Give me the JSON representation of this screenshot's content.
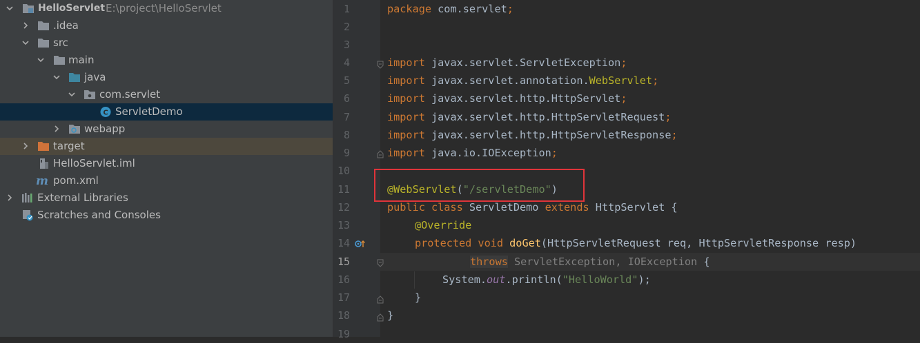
{
  "project_tree": {
    "root": {
      "name": "HelloServlet",
      "path": "E:\\project\\HelloServlet"
    },
    "items": [
      {
        "label": ".idea"
      },
      {
        "label": "src"
      },
      {
        "label": "main"
      },
      {
        "label": "java"
      },
      {
        "label": "com.servlet"
      },
      {
        "label": "ServletDemo"
      },
      {
        "label": "webapp"
      },
      {
        "label": "target"
      },
      {
        "label": "HelloServlet.iml"
      },
      {
        "label": "pom.xml"
      },
      {
        "label": "External Libraries"
      },
      {
        "label": "Scratches and Consoles"
      }
    ]
  },
  "editor": {
    "line_numbers": [
      "1",
      "2",
      "3",
      "4",
      "5",
      "6",
      "7",
      "8",
      "9",
      "10",
      "11",
      "12",
      "13",
      "14",
      "15",
      "16",
      "17",
      "18",
      "19"
    ],
    "current_line": "15",
    "tokens": {
      "package_kw": "package",
      "package_name": " com.servlet",
      "semi": ";",
      "import_kw": "import",
      "imp4": " javax.servlet.ServletException",
      "imp5a": " javax.servlet.annotation.",
      "imp5b": "WebServlet",
      "imp6": " javax.servlet.http.HttpServlet",
      "imp7": " javax.servlet.http.HttpServletRequest",
      "imp8": " javax.servlet.http.HttpServletResponse",
      "imp9": " java.io.IOException",
      "ann_webservlet": "@WebServlet",
      "paren_open": "(",
      "servlet_path": "\"/servletDemo\"",
      "paren_close": ")",
      "public_class": "public class ",
      "class_name": "ServletDemo ",
      "extends_kw": "extends ",
      "super_class": "HttpServlet {",
      "override": "@Override",
      "protected_void": "protected void ",
      "method_name": "doGet",
      "method_params": "(HttpServletRequest req, HttpServletResponse resp)",
      "throws_kw": "throws",
      "throws_rest": " ServletException, IOException ",
      "open_brace": "{",
      "sys": "System.",
      "out": "out",
      "println": ".println(",
      "hello": "\"HelloWorld\"",
      "println_end": ");",
      "close_brace": "}",
      "close_brace_class": "}"
    }
  },
  "colors": {
    "keyword": "#cc7832",
    "annotation": "#bbb529",
    "string": "#6a8759",
    "highlight_box": "#e0343a",
    "selection": "#0d293e"
  }
}
